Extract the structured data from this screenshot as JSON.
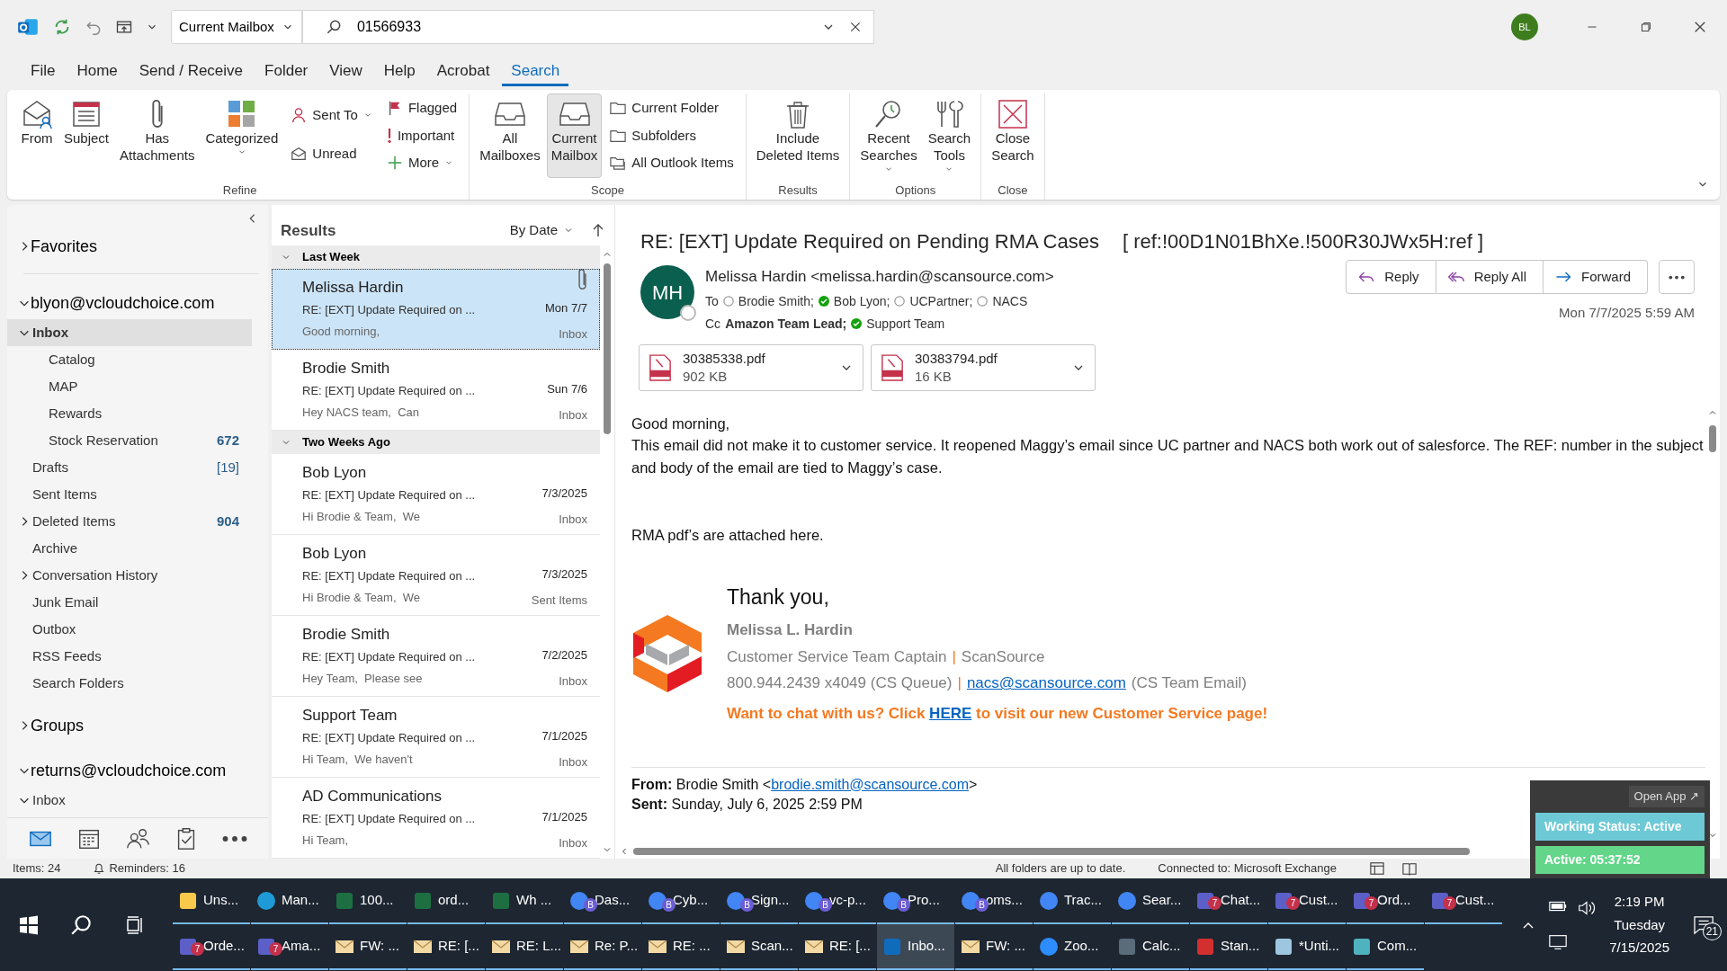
{
  "titlebar": {
    "scope": "Current Mailbox",
    "search": "01566933",
    "avatar": "BL"
  },
  "menu_tabs": [
    {
      "label": "File",
      "selected": false
    },
    {
      "label": "Home",
      "selected": false
    },
    {
      "label": "Send / Receive",
      "selected": false
    },
    {
      "label": "Folder",
      "selected": false
    },
    {
      "label": "View",
      "selected": false
    },
    {
      "label": "Help",
      "selected": false
    },
    {
      "label": "Acrobat",
      "selected": false
    },
    {
      "label": "Search",
      "selected": true
    }
  ],
  "ribbon": [
    {
      "label": "Refine",
      "columns": [
        {
          "kind": "large",
          "label": "From",
          "dropdown": false,
          "selected": false
        },
        {
          "kind": "large",
          "label": "Subject",
          "dropdown": false,
          "selected": false
        },
        {
          "kind": "large",
          "label": "Has\nAttachments",
          "dropdown": false,
          "selected": false
        },
        {
          "kind": "large",
          "label": "Categorized",
          "dropdown": true,
          "selected": false
        },
        {
          "kind": "stack",
          "buttons": [
            {
              "label": "Sent To",
              "dropdown": true,
              "selected": false
            },
            {
              "label": "Unread",
              "dropdown": false,
              "selected": false
            }
          ]
        },
        {
          "kind": "stack",
          "buttons": [
            {
              "label": "Flagged",
              "dropdown": false,
              "selected": false
            },
            {
              "label": "Important",
              "dropdown": false,
              "selected": false
            },
            {
              "label": "More",
              "dropdown": true,
              "selected": false
            }
          ]
        }
      ]
    },
    {
      "label": "Scope",
      "columns": [
        {
          "kind": "large",
          "label": "All\nMailboxes",
          "dropdown": false,
          "selected": false
        },
        {
          "kind": "large",
          "label": "Current\nMailbox",
          "dropdown": false,
          "selected": true
        },
        {
          "kind": "stack",
          "buttons": [
            {
              "label": "Current Folder",
              "dropdown": false,
              "selected": false
            },
            {
              "label": "Subfolders",
              "dropdown": false,
              "selected": false
            },
            {
              "label": "All Outlook Items",
              "dropdown": false,
              "selected": false
            }
          ]
        }
      ]
    },
    {
      "label": "Results",
      "columns": [
        {
          "kind": "large",
          "label": "Include\nDeleted Items",
          "dropdown": false,
          "selected": false
        }
      ]
    },
    {
      "label": "Options",
      "columns": [
        {
          "kind": "large",
          "label": "Recent\nSearches",
          "dropdown": true,
          "selected": false
        },
        {
          "kind": "large",
          "label": "Search\nTools",
          "dropdown": true,
          "selected": false
        }
      ]
    },
    {
      "label": "Close",
      "columns": [
        {
          "kind": "large",
          "label": "Close\nSearch",
          "dropdown": false,
          "selected": false
        }
      ]
    }
  ],
  "folder_pane": {
    "sections": [
      {
        "label": "Favorites",
        "expanded": false
      },
      {
        "label": "blyon@vcloudchoice.com",
        "expanded": true,
        "folders": [
          {
            "label": "Inbox",
            "expanded": true,
            "selected": true,
            "children": [
              {
                "label": "Catalog",
                "selected": false
              },
              {
                "label": "MAP",
                "selected": false
              },
              {
                "label": "Rewards",
                "selected": false
              },
              {
                "label": "Stock Reservation",
                "count": "672",
                "unread": true,
                "selected": false
              }
            ]
          },
          {
            "label": "Drafts",
            "count": "[19]",
            "unread": false,
            "selected": false
          },
          {
            "label": "Sent Items",
            "selected": false
          },
          {
            "label": "Deleted Items",
            "count": "904",
            "unread": true,
            "expanded": false,
            "selected": false
          },
          {
            "label": "Archive",
            "selected": false
          },
          {
            "label": "Conversation History",
            "expanded": false,
            "selected": false
          },
          {
            "label": "Junk Email",
            "selected": false
          },
          {
            "label": "Outbox",
            "selected": false
          },
          {
            "label": "RSS Feeds",
            "selected": false
          },
          {
            "label": "Search Folders",
            "selected": false
          }
        ]
      },
      {
        "label": "Groups",
        "expanded": false
      },
      {
        "label": "returns@vcloudchoice.com",
        "expanded": true,
        "folders": [
          {
            "label": "Inbox",
            "expanded": true,
            "selected": false
          }
        ]
      }
    ]
  },
  "message_list": {
    "title": "Results",
    "sort": "By Date",
    "groups": [
      {
        "label": "Last Week",
        "expanded": true,
        "messages": [
          {
            "sender": "Melissa Hardin",
            "subject": "RE: [EXT] Update Required on ...",
            "preview": "Good morning,",
            "date": "Mon 7/7",
            "folder": "Inbox",
            "attachment": true,
            "selected": true
          },
          {
            "sender": "Brodie Smith",
            "subject": "RE: [EXT] Update Required on ...",
            "preview": "Hey NACS team,  Can",
            "date": "Sun 7/6",
            "folder": "Inbox",
            "attachment": false,
            "selected": false
          }
        ]
      },
      {
        "label": "Two Weeks Ago",
        "expanded": true,
        "messages": [
          {
            "sender": "Bob Lyon",
            "subject": "RE: [EXT] Update Required on ...",
            "preview": "Hi Brodie & Team,  We",
            "date": "7/3/2025",
            "folder": "Inbox",
            "attachment": false,
            "selected": false
          },
          {
            "sender": "Bob Lyon",
            "subject": "RE: [EXT] Update Required on ...",
            "preview": "Hi Brodie & Team,  We",
            "date": "7/3/2025",
            "folder": "Sent Items",
            "attachment": false,
            "selected": false
          },
          {
            "sender": "Brodie Smith",
            "subject": "RE: [EXT] Update Required on ...",
            "preview": "Hey Team,  Please see",
            "date": "7/2/2025",
            "folder": "Inbox",
            "attachment": false,
            "selected": false
          },
          {
            "sender": "Support Team",
            "subject": "RE: [EXT] Update Required on ...",
            "preview": "Hi Team,  We haven't",
            "date": "7/1/2025",
            "folder": "Inbox",
            "attachment": false,
            "selected": false
          },
          {
            "sender": "AD Communications",
            "subject": "RE: [EXT] Update Required on ...",
            "preview": "Hi Team,",
            "date": "7/1/2025",
            "folder": "Inbox",
            "attachment": false,
            "selected": false
          }
        ]
      }
    ]
  },
  "reading_pane": {
    "subject": "RE: [EXT] Update Required on Pending RMA Cases",
    "ref": "[ ref:!00D1N01BhXe.!500R30JWx5H:ref ]",
    "initials": "MH",
    "from": "Melissa Hardin <melissa.hardin@scansource.com>",
    "to_label": "To",
    "to": [
      {
        "name": "Brodie Smith;",
        "available": false,
        "bold": false
      },
      {
        "name": "Bob Lyon;",
        "available": true,
        "bold": false
      },
      {
        "name": "UCPartner;",
        "available": false,
        "bold": false
      },
      {
        "name": "NACS",
        "available": false,
        "bold": false
      }
    ],
    "cc_label": "Cc",
    "cc": [
      {
        "name": "Amazon Team Lead;",
        "bold": true
      },
      {
        "name": "Support Team",
        "available": true,
        "bold": false
      }
    ],
    "date": "Mon 7/7/2025 5:59 AM",
    "actions": [
      "Reply",
      "Reply All",
      "Forward"
    ],
    "attachments": [
      {
        "name": "30385338.pdf",
        "size": "902 KB"
      },
      {
        "name": "30383794.pdf",
        "size": "16 KB"
      }
    ],
    "body": [
      [
        "Good morning,",
        "This email did not make it to customer service. It reopened Maggy’s email since UC partner and NACS both work out of salesforce. The REF: number in the subject and body of the email are tied to Maggy’s case."
      ],
      [
        "RMA pdf’s are attached here."
      ]
    ],
    "signature": {
      "closing": "Thank you,",
      "name": "Melissa L. Hardin",
      "title": "Customer Service Team Captain",
      "separator": "|",
      "company": "ScanSource",
      "phone": "800.944.2439 x4049 (CS Queue)",
      "email": "nacs@scansource.com",
      "email_note": "(CS Team Email)",
      "chat_before": "Want to chat with us? Click",
      "chat_link": "HERE",
      "chat_after": "to visit our new Customer Service page!"
    },
    "quoted": {
      "from_label": "From:",
      "from_name": "Brodie Smith <",
      "from_email": "brodie.smith@scansource.com",
      "from_end": ">",
      "sent_label": "Sent:",
      "sent": "Sunday, July 6, 2025 2:59 PM"
    }
  },
  "status_bar": {
    "items": "Items: 24",
    "reminders": "Reminders: 16",
    "sync": "All folders are up to date.",
    "connection": "Connected to: Microsoft Exchange"
  },
  "overlay": {
    "open_app": "Open App ↗",
    "status": "Working Status: Active",
    "timer": "Active: 05:37:52"
  },
  "taskbar": {
    "rows": [
      [
        {
          "label": "Uns...",
          "kind": "folder",
          "selected": false
        },
        {
          "label": "Man...",
          "kind": "edge",
          "selected": false
        },
        {
          "label": "100...",
          "kind": "excel",
          "selected": false
        },
        {
          "label": "ord...",
          "kind": "excel",
          "selected": false
        },
        {
          "label": "Wh ...",
          "kind": "excel",
          "selected": false
        },
        {
          "label": "Das...",
          "kind": "chrome",
          "badge": "B",
          "selected": false
        },
        {
          "label": "Cyb...",
          "kind": "chrome",
          "badge": "B",
          "selected": false
        },
        {
          "label": "Sign...",
          "kind": "chrome",
          "badge": "B",
          "selected": false
        },
        {
          "label": "vc-p...",
          "kind": "chrome",
          "badge": "B",
          "selected": false
        },
        {
          "label": "Pro...",
          "kind": "chrome",
          "badge": "B",
          "selected": false
        },
        {
          "label": "oms...",
          "kind": "chrome",
          "badge": "B",
          "selected": false
        },
        {
          "label": "Trac...",
          "kind": "chrome",
          "selected": false
        },
        {
          "label": "Sear...",
          "kind": "chrome",
          "selected": false
        },
        {
          "label": "Chat...",
          "kind": "teams",
          "badge": "7",
          "selected": false
        },
        {
          "label": "Cust...",
          "kind": "teams",
          "badge": "7",
          "selected": false
        },
        {
          "label": "Ord...",
          "kind": "teams",
          "badge": "7",
          "selected": false
        },
        {
          "label": "Cust...",
          "kind": "teams",
          "badge": "7",
          "selected": false
        }
      ],
      [
        {
          "label": "Orde...",
          "kind": "teams",
          "badge": "7",
          "selected": false
        },
        {
          "label": "Ama...",
          "kind": "teams",
          "badge": "7",
          "selected": false
        },
        {
          "label": "FW: ...",
          "kind": "mail",
          "selected": false
        },
        {
          "label": "RE: [...",
          "kind": "mail",
          "selected": false
        },
        {
          "label": "RE: L...",
          "kind": "mail",
          "selected": false
        },
        {
          "label": "Re: P...",
          "kind": "mail",
          "selected": false
        },
        {
          "label": "RE: ...",
          "kind": "mail",
          "selected": false
        },
        {
          "label": "Scan...",
          "kind": "mail",
          "selected": false
        },
        {
          "label": "RE: [...",
          "kind": "mail",
          "selected": false
        },
        {
          "label": "Inbo...",
          "kind": "outlook",
          "selected": true
        },
        {
          "label": "FW: ...",
          "kind": "mail",
          "selected": false
        },
        {
          "label": "Zoo...",
          "kind": "zoom",
          "selected": false
        },
        {
          "label": "Calc...",
          "kind": "calculator",
          "selected": false
        },
        {
          "label": "Stan...",
          "kind": "pdf",
          "selected": false
        },
        {
          "label": "*Unti...",
          "kind": "notepad",
          "selected": false
        },
        {
          "label": "Com...",
          "kind": "app",
          "selected": false
        }
      ]
    ],
    "tray": {
      "time": "2:19 PM",
      "day": "Tuesday",
      "date": "7/15/2025",
      "notifications": "21"
    }
  }
}
